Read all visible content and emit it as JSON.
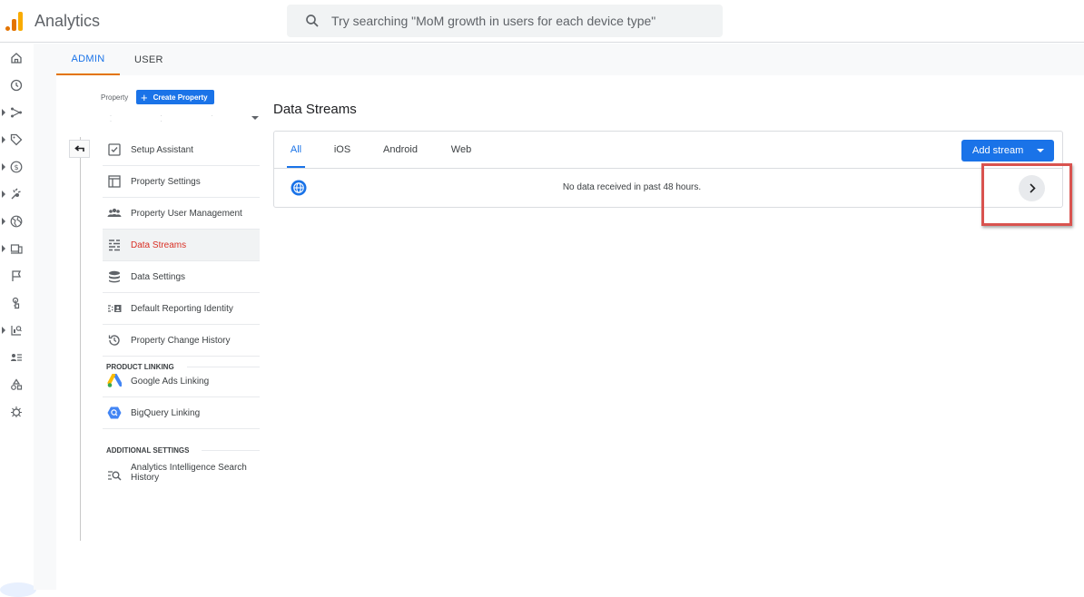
{
  "app": {
    "title": "Analytics"
  },
  "search": {
    "placeholder": "Try searching \"MoM growth in users for each device type\""
  },
  "top_tabs": [
    {
      "label": "ADMIN"
    },
    {
      "label": "USER"
    }
  ],
  "property": {
    "label": "Property",
    "create_label": "Create Property"
  },
  "menu": {
    "items": [
      {
        "label": "Setup Assistant",
        "icon": "checklist-icon"
      },
      {
        "label": "Property Settings",
        "icon": "settings-window-icon"
      },
      {
        "label": "Property User Management",
        "icon": "users-icon"
      },
      {
        "label": "Data Streams",
        "icon": "streams-icon"
      },
      {
        "label": "Data Settings",
        "icon": "database-icon"
      },
      {
        "label": "Default Reporting Identity",
        "icon": "identity-icon"
      },
      {
        "label": "Property Change History",
        "icon": "history-icon"
      }
    ],
    "product_linking": "PRODUCT LINKING",
    "linking_items": [
      {
        "label": "Google Ads Linking",
        "icon": "google-ads-icon"
      },
      {
        "label": "BigQuery Linking",
        "icon": "bigquery-icon"
      }
    ],
    "additional_settings": "ADDITIONAL SETTINGS",
    "additional_items": [
      {
        "label": "Analytics Intelligence Search History",
        "icon": "search-history-icon"
      }
    ]
  },
  "data_streams": {
    "title": "Data Streams",
    "tabs": [
      {
        "label": "All"
      },
      {
        "label": "iOS"
      },
      {
        "label": "Android"
      },
      {
        "label": "Web"
      }
    ],
    "add_stream": "Add stream",
    "row_status": "No data received in past 48 hours."
  },
  "colors": {
    "accent": "#1a73e8",
    "active_menu": "#d93025",
    "tab_underline": "#e37400",
    "highlight": "#d9534f"
  }
}
